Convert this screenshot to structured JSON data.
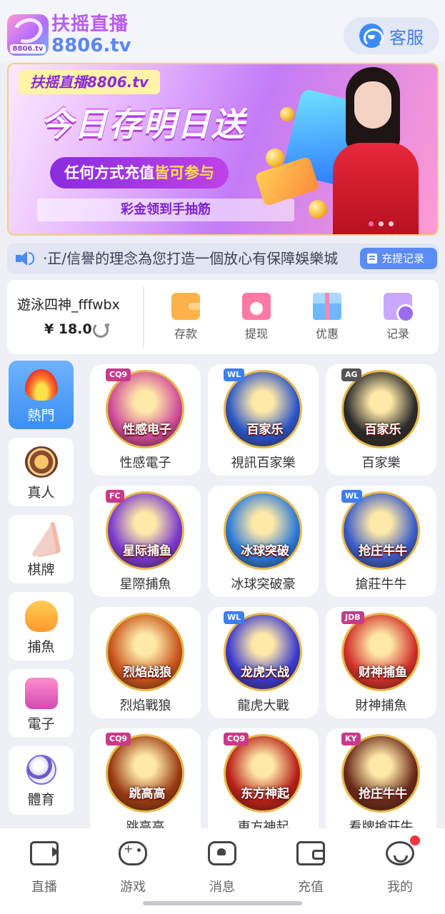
{
  "header": {
    "logo_cn": "扶摇直播",
    "logo_en": "8806.tv",
    "logo_tag": "8806.tv",
    "service_label": "客服"
  },
  "banner": {
    "brand": "扶摇直播8806.tv",
    "headline": "今日存明日送",
    "pill_prefix": "任何方式充值",
    "pill_highlight": "皆可参与",
    "footer": "彩金领到手抽筋"
  },
  "notice": {
    "text": "·正/信譽的理念為您打造一個放心有保障娛樂城",
    "records_button": "充提记录"
  },
  "account": {
    "username": "遊泳四神_fffwbx",
    "balance": "¥ 18.0",
    "actions": [
      {
        "label": "存款",
        "icon": "wallet-icon"
      },
      {
        "label": "提现",
        "icon": "withdraw-icon"
      },
      {
        "label": "优惠",
        "icon": "gift-icon"
      },
      {
        "label": "记录",
        "icon": "records-folder-icon"
      }
    ]
  },
  "categories": [
    {
      "label": "熱門",
      "icon": "fire-icon",
      "active": true
    },
    {
      "label": "真人",
      "icon": "casino-chip-icon"
    },
    {
      "label": "棋牌",
      "icon": "playing-cards-icon"
    },
    {
      "label": "捕魚",
      "icon": "shark-icon"
    },
    {
      "label": "電子",
      "icon": "slot-machine-icon"
    },
    {
      "label": "體育",
      "icon": "soccer-ball-icon"
    }
  ],
  "games": [
    {
      "name": "性感電子",
      "badge": "CQ9",
      "art": "性感电子",
      "color": "#d04a9a"
    },
    {
      "name": "視訊百家樂",
      "badge": "WL",
      "art": "百家乐",
      "color": "#2a54c8"
    },
    {
      "name": "百家樂",
      "badge": "AG",
      "art": "百家乐",
      "color": "#2b2b2b"
    },
    {
      "name": "星際捕魚",
      "badge": "FC",
      "art": "星际捕鱼",
      "color": "#7a3ad0"
    },
    {
      "name": "冰球突破豪",
      "badge": "",
      "art": "冰球突破",
      "color": "#2a7ad8"
    },
    {
      "name": "搶莊牛牛",
      "badge": "WL",
      "art": "抢庄牛牛",
      "color": "#3a5cc8"
    },
    {
      "name": "烈焰戰狼",
      "badge": "",
      "art": "烈焰战狼",
      "color": "#c8541a"
    },
    {
      "name": "龍虎大戰",
      "badge": "WL",
      "art": "龙虎大战",
      "color": "#3a3ad0"
    },
    {
      "name": "財神捕魚",
      "badge": "JDB",
      "art": "财神捕鱼",
      "color": "#d0302a"
    },
    {
      "name": "跳高高",
      "badge": "CQ9",
      "art": "跳高高",
      "color": "#9a3a12"
    },
    {
      "name": "東方神起",
      "badge": "CQ9",
      "art": "东方神起",
      "color": "#b8201a"
    },
    {
      "name": "看牌搶莊牛",
      "badge": "KY",
      "art": "抢庄牛牛",
      "color": "#6a2a1a"
    }
  ],
  "tabbar": [
    {
      "label": "直播",
      "icon": "live-camera-icon"
    },
    {
      "label": "游戏",
      "icon": "gamepad-icon"
    },
    {
      "label": "消息",
      "icon": "message-icon"
    },
    {
      "label": "充值",
      "icon": "wallet-outline-icon"
    },
    {
      "label": "我的",
      "icon": "profile-face-icon"
    }
  ]
}
